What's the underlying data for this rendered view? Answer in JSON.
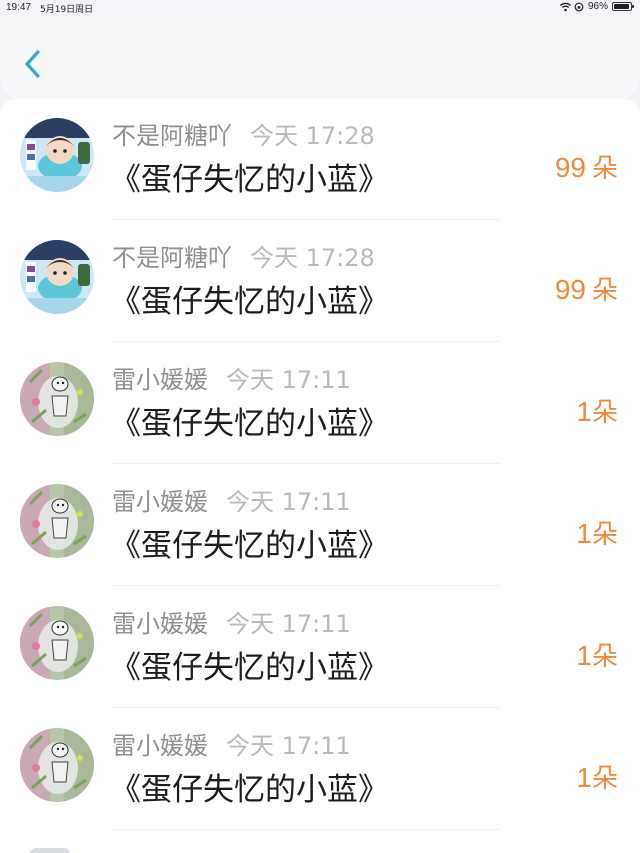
{
  "status_bar": {
    "time": "19:47",
    "date": "5月19日周日",
    "battery_percent": "96%",
    "battery_level": 0.96
  },
  "nav": {
    "back_icon": "chevron-left-icon",
    "accent_color": "#3aa0e8"
  },
  "colors": {
    "count": "#ef8a3c",
    "username": "#8f8f8f",
    "timestamp": "#b9b9b9",
    "content": "#1d1d1d"
  },
  "rows": [
    {
      "username": "不是阿糖吖",
      "time": "今天 17:28",
      "content": "《蛋仔失忆的小蓝》",
      "count": "99",
      "unit": "朵",
      "avatar": "avatar-game"
    },
    {
      "username": "不是阿糖吖",
      "time": "今天 17:28",
      "content": "《蛋仔失忆的小蓝》",
      "count": "99",
      "unit": "朵",
      "avatar": "avatar-game"
    },
    {
      "username": "雷小媛媛",
      "time": "今天 17:11",
      "content": "《蛋仔失忆的小蓝》",
      "count": "1",
      "unit": "朵",
      "avatar": "avatar-sticker"
    },
    {
      "username": "雷小媛媛",
      "time": "今天 17:11",
      "content": "《蛋仔失忆的小蓝》",
      "count": "1",
      "unit": "朵",
      "avatar": "avatar-sticker"
    },
    {
      "username": "雷小媛媛",
      "time": "今天 17:11",
      "content": "《蛋仔失忆的小蓝》",
      "count": "1",
      "unit": "朵",
      "avatar": "avatar-sticker"
    },
    {
      "username": "雷小媛媛",
      "time": "今天 17:11",
      "content": "《蛋仔失忆的小蓝》",
      "count": "1",
      "unit": "朵",
      "avatar": "avatar-sticker"
    }
  ]
}
